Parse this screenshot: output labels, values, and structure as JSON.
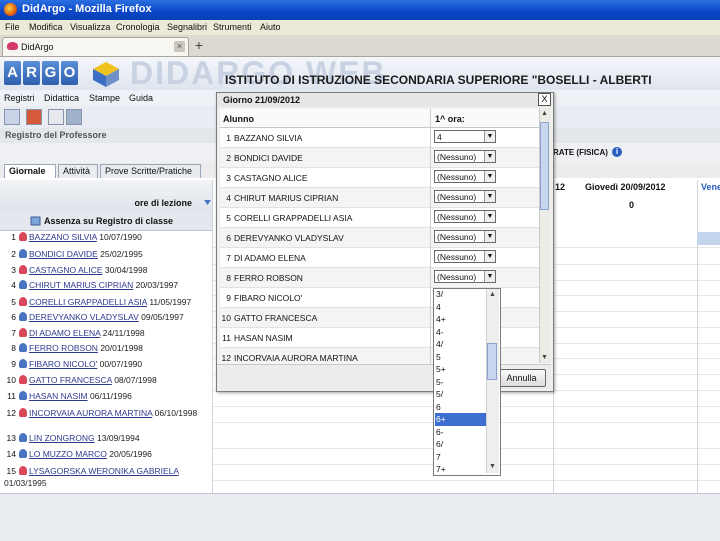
{
  "window": {
    "title": "DidArgo - Mozilla Firefox"
  },
  "menubar": [
    "File",
    "Modifica",
    "Visualizza",
    "Cronologia",
    "Segnalibri",
    "Strumenti",
    "Aiuto"
  ],
  "browser_tab": {
    "label": "DidArgo",
    "close": "×",
    "new_tab": "+"
  },
  "app": {
    "argo_letters": [
      "A",
      "R",
      "G",
      "O"
    ],
    "logo_text": "DIDARGO WEB",
    "institute": "ISTITUTO DI ISTRUZIONE SECONDARIA SUPERIORE \"BOSELLI - ALBERTI",
    "menu": [
      "Registri",
      "Didattica",
      "Stampe",
      "Guida"
    ],
    "section_title": "Registro del Professore",
    "subject": "RATE (FISICA)",
    "info_icon": "i",
    "sub_tabs": [
      "Giornale",
      "Attività",
      "Prove Scritte/Pratiche"
    ],
    "ore_label": "ore di lezione",
    "assenza_label": "Assenza su Registro di classe",
    "day_headers": [
      {
        "label": "12",
        "value": ""
      },
      {
        "label": "Giovedì 20/09/2012",
        "value": "0"
      },
      {
        "label": "Vene",
        "value": ""
      }
    ]
  },
  "students": [
    {
      "num": "1",
      "name": "BAZZANO SILVIA",
      "date": "10/07/1990",
      "gender": "f"
    },
    {
      "num": "2",
      "name": "BONDICI DAVIDE",
      "date": "25/02/1995",
      "gender": "m"
    },
    {
      "num": "3",
      "name": "CASTAGNO ALICE",
      "date": "30/04/1998",
      "gender": "f"
    },
    {
      "num": "4",
      "name": "CHIRUT MARIUS CIPRIAN",
      "date": "20/03/1997",
      "gender": "m"
    },
    {
      "num": "5",
      "name": "CORELLI GRAPPADELLI ASIA",
      "date": "11/05/1997",
      "gender": "f"
    },
    {
      "num": "6",
      "name": "DEREVYANKO VLADYSLAV",
      "date": "09/05/1997",
      "gender": "m"
    },
    {
      "num": "7",
      "name": "DI ADAMO ELENA",
      "date": "24/11/1998",
      "gender": "f"
    },
    {
      "num": "8",
      "name": "FERRO ROBSON",
      "date": "20/01/1998",
      "gender": "m"
    },
    {
      "num": "9",
      "name": "FIBARO NICOLO'",
      "date": "00/07/1990",
      "gender": "m"
    },
    {
      "num": "10",
      "name": "GATTO FRANCESCA",
      "date": "08/07/1998",
      "gender": "f"
    },
    {
      "num": "11",
      "name": "HASAN NASIM",
      "date": "06/11/1996",
      "gender": "m"
    },
    {
      "num": "12",
      "name": "INCORVAIA AURORA MARTINA",
      "date": "06/10/1998",
      "gender": "f"
    },
    {
      "num": "13",
      "name": "LIN ZONGRONG",
      "date": "13/09/1994",
      "gender": "m"
    },
    {
      "num": "14",
      "name": "LO MUZZO MARCO",
      "date": "20/05/1996",
      "gender": "m"
    },
    {
      "num": "15",
      "name": "LYSAGORSKA WERONIKA GABRIELA",
      "date": "01/03/1995",
      "gender": "f"
    }
  ],
  "dialog": {
    "title": "Giorno 21/09/2012",
    "close": "X",
    "col_alunno": "Alunno",
    "col_ora": "1^ ora:",
    "cancel_label": "Annulla",
    "rows": [
      {
        "num": "1",
        "name": "BAZZANO SILVIA",
        "value": "4"
      },
      {
        "num": "2",
        "name": "BONDICI DAVIDE",
        "value": "(Nessuno)"
      },
      {
        "num": "3",
        "name": "CASTAGNO ALICE",
        "value": "(Nessuno)"
      },
      {
        "num": "4",
        "name": "CHIRUT MARIUS CIPRIAN",
        "value": "(Nessuno)"
      },
      {
        "num": "5",
        "name": "CORELLI GRAPPADELLI ASIA",
        "value": "(Nessuno)"
      },
      {
        "num": "6",
        "name": "DEREVYANKO VLADYSLAV",
        "value": "(Nessuno)"
      },
      {
        "num": "7",
        "name": "DI ADAMO ELENA",
        "value": "(Nessuno)"
      },
      {
        "num": "8",
        "name": "FERRO ROBSON",
        "value": "(Nessuno)"
      },
      {
        "num": "9",
        "name": "FIBARO NICOLO'",
        "value": ""
      },
      {
        "num": "10",
        "name": "GATTO FRANCESCA",
        "value": ""
      },
      {
        "num": "11",
        "name": "HASAN NASIM",
        "value": ""
      },
      {
        "num": "12",
        "name": "INCORVAIA AURORA MARTINA",
        "value": ""
      }
    ],
    "dropdown_options": [
      "3/",
      "4",
      "4+",
      "4-",
      "4/",
      "5",
      "5+",
      "5-",
      "5/",
      "6",
      "6+",
      "6-",
      "6/",
      "7",
      "7+"
    ],
    "dropdown_selected_index": 10
  },
  "colors": {
    "titlebar": "#0a46c8",
    "accent": "#3d6fd0",
    "female_icon": "#d9475a",
    "male_icon": "#4a74c2"
  }
}
